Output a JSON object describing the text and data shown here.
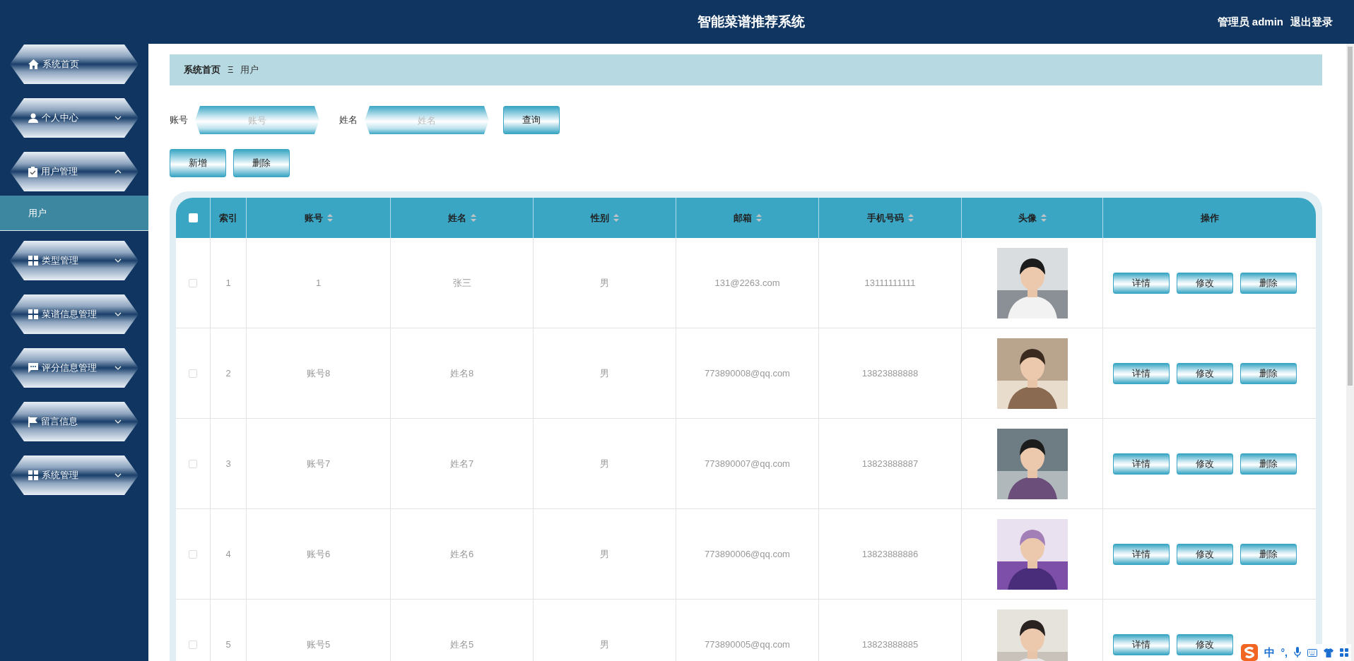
{
  "header": {
    "title": "智能菜谱推荐系统",
    "user": "管理员 admin",
    "logout": "退出登录"
  },
  "sidebar": {
    "items": [
      {
        "label": "系统首页"
      },
      {
        "label": "个人中心",
        "expanded": false
      },
      {
        "label": "用户管理",
        "expanded": true,
        "children": [
          {
            "label": "用户",
            "selected": true
          }
        ]
      },
      {
        "label": "类型管理",
        "expanded": false
      },
      {
        "label": "菜谱信息管理",
        "expanded": false
      },
      {
        "label": "评分信息管理",
        "expanded": false
      },
      {
        "label": "留言信息",
        "expanded": false
      },
      {
        "label": "系统管理",
        "expanded": false
      }
    ]
  },
  "breadcrumb": {
    "home": "系统首页",
    "separator": "Ξ",
    "current": "用户"
  },
  "search": {
    "fields": [
      {
        "label": "账号",
        "placeholder": "账号"
      },
      {
        "label": "姓名",
        "placeholder": "姓名"
      }
    ],
    "button": "查询"
  },
  "toolbar": [
    "新增",
    "删除"
  ],
  "table": {
    "columns": [
      {
        "label": "索引",
        "sortable": false
      },
      {
        "label": "账号",
        "sortable": true
      },
      {
        "label": "姓名",
        "sortable": true
      },
      {
        "label": "性别",
        "sortable": true
      },
      {
        "label": "邮箱",
        "sortable": true
      },
      {
        "label": "手机号码",
        "sortable": true
      },
      {
        "label": "头像",
        "sortable": true
      },
      {
        "label": "操作",
        "sortable": false
      }
    ],
    "select_all_checked": false,
    "rows": [
      {
        "checked": false,
        "index": "1",
        "account": "1",
        "name": "张三",
        "gender": "男",
        "email": "131@2263.com",
        "phone": "13111111111",
        "avatar": {
          "kind": "picture"
        },
        "actions": [
          "详情",
          "修改",
          "删除"
        ]
      },
      {
        "checked": false,
        "index": "2",
        "account": "账号8",
        "name": "姓名8",
        "gender": "男",
        "email": "773890008@qq.com",
        "phone": "13823888888",
        "avatar": {
          "kind": "picture"
        },
        "actions": [
          "详情",
          "修改",
          "删除"
        ]
      },
      {
        "checked": false,
        "index": "3",
        "account": "账号7",
        "name": "姓名7",
        "gender": "男",
        "email": "773890007@qq.com",
        "phone": "13823888887",
        "avatar": {
          "kind": "picture"
        },
        "actions": [
          "详情",
          "修改",
          "删除"
        ]
      },
      {
        "checked": false,
        "index": "4",
        "account": "账号6",
        "name": "姓名6",
        "gender": "男",
        "email": "773890006@qq.com",
        "phone": "13823888886",
        "avatar": {
          "kind": "picture"
        },
        "actions": [
          "详情",
          "修改",
          "删除"
        ]
      },
      {
        "checked": false,
        "index": "5",
        "account": "账号5",
        "name": "姓名5",
        "gender": "男",
        "email": "773890005@qq.com",
        "phone": "13823888885",
        "avatar": {
          "kind": "picture"
        },
        "actions": [
          "详情",
          "修改"
        ]
      }
    ]
  },
  "ime_bar": {
    "mode": "中",
    "punctuation": "°,"
  }
}
